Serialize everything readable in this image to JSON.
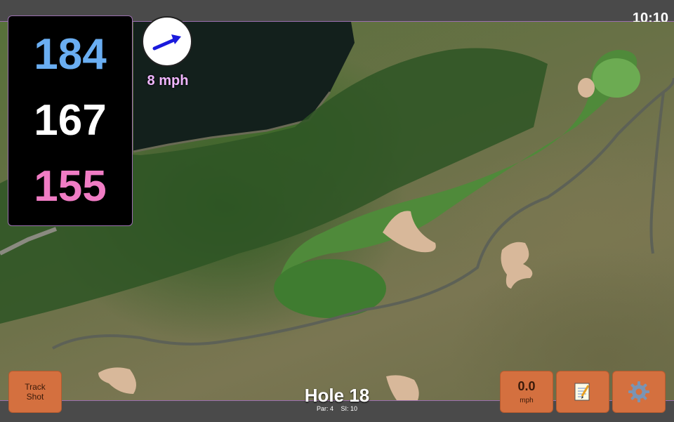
{
  "status_bar": {
    "time": "10:10"
  },
  "distances": {
    "back": "184",
    "center": "167",
    "front": "155"
  },
  "wind": {
    "speed": "8 mph",
    "direction_icon": "arrow-icon"
  },
  "hole": {
    "title": "Hole 18",
    "par": "Par: 4",
    "stroke_index": "SI: 10"
  },
  "buttons": {
    "track_shot_line1": "Track",
    "track_shot_line2": "Shot",
    "speed_value": "0.0",
    "speed_unit": "mph",
    "notes_icon": "notepad-icon",
    "settings_icon": "gear-icon"
  },
  "colors": {
    "back": "#6aaef2",
    "center": "#ffffff",
    "front": "#f07cc4",
    "button": "#d4703f",
    "wind_speed": "#f1b6ff"
  }
}
